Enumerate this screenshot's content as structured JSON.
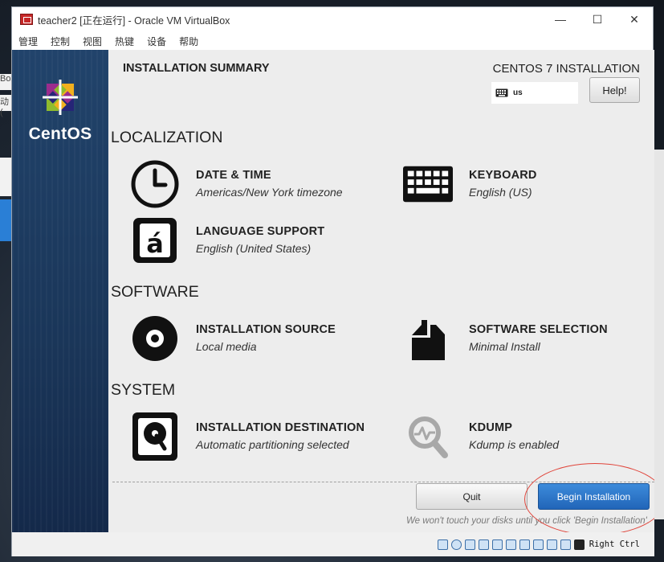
{
  "window": {
    "title": "teacher2 [正在运行] - Oracle VM VirtualBox",
    "controls": {
      "minimize": "—",
      "maximize": "☐",
      "close": "✕"
    }
  },
  "menu": [
    "管理",
    "控制",
    "视图",
    "热键",
    "设备",
    "帮助"
  ],
  "desktop_fragments": [
    "Box",
    "动("
  ],
  "installer": {
    "brand": "CentOS",
    "header_title": "INSTALLATION SUMMARY",
    "product": "CENTOS 7 INSTALLATION",
    "keyboard_layout": "us",
    "help_label": "Help!",
    "sections": {
      "localization": "LOCALIZATION",
      "software": "SOFTWARE",
      "system": "SYSTEM"
    },
    "spokes": {
      "datetime": {
        "title": "DATE & TIME",
        "status": "Americas/New York timezone",
        "icon": "clock-icon"
      },
      "keyboard": {
        "title": "KEYBOARD",
        "status": "English (US)",
        "icon": "keyboard-icon"
      },
      "language": {
        "title": "LANGUAGE SUPPORT",
        "status": "English (United States)",
        "icon": "language-icon"
      },
      "source": {
        "title": "INSTALLATION SOURCE",
        "status": "Local media",
        "icon": "disc-icon"
      },
      "selection": {
        "title": "SOFTWARE SELECTION",
        "status": "Minimal Install",
        "icon": "package-icon"
      },
      "destination": {
        "title": "INSTALLATION DESTINATION",
        "status": "Automatic partitioning selected",
        "icon": "harddisk-icon"
      },
      "kdump": {
        "title": "KDUMP",
        "status": "Kdump is enabled",
        "icon": "kdump-search-icon"
      }
    },
    "quit_label": "Quit",
    "begin_label": "Begin Installation",
    "hint": "We won't touch your disks until you click 'Begin Installation'."
  },
  "statusbar": {
    "host_key": "Right Ctrl"
  },
  "colors": {
    "accent": "#2a6fc4",
    "sidebar": "#1d3b60",
    "annotation": "#e0443a"
  }
}
